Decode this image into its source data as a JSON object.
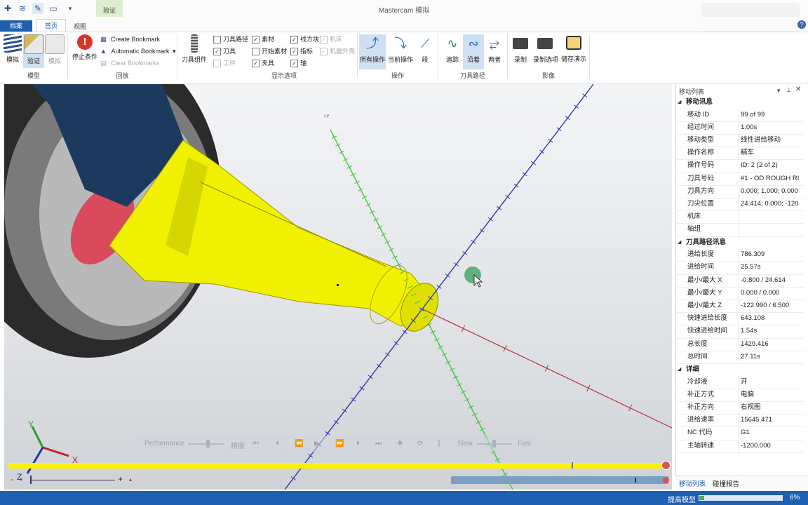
{
  "app": {
    "title": "Mastercam 模拟",
    "context_tab": "验证",
    "context_tab_sub": "验证"
  },
  "tabs": {
    "file": "档案",
    "home": "首页",
    "view": "视图"
  },
  "ribbon": {
    "model_group": {
      "label": "模型",
      "simulate": "模拟",
      "verify": "验证",
      "simulate2": "模拟"
    },
    "playback_group": {
      "label": "回放",
      "stop_condition": "停止条件",
      "create_bookmark": "Create Bookmark",
      "auto_bookmark": "Automatic Bookmark",
      "clear_bookmarks": "Clear Bookmarks"
    },
    "display_group": {
      "label": "显示选项",
      "tool_assembly": "刀具组件",
      "options": [
        {
          "label": "刀具路径",
          "checked": false,
          "disabled": false
        },
        {
          "label": "素材",
          "checked": true,
          "disabled": false
        },
        {
          "label": "线方块",
          "checked": true,
          "disabled": false
        },
        {
          "label": "机床",
          "checked": true,
          "disabled": true
        },
        {
          "label": "刀具",
          "checked": true,
          "disabled": false
        },
        {
          "label": "开始素材",
          "checked": false,
          "disabled": false
        },
        {
          "label": "指标",
          "checked": true,
          "disabled": false
        },
        {
          "label": "机器外壳",
          "checked": true,
          "disabled": true
        },
        {
          "label": "工件",
          "checked": false,
          "disabled": true
        },
        {
          "label": "夹具",
          "checked": true,
          "disabled": false
        },
        {
          "label": "轴",
          "checked": true,
          "disabled": false
        }
      ]
    },
    "operation_group": {
      "label": "操作",
      "all_ops": "所有操作",
      "current_op": "当前操作",
      "segment": "段"
    },
    "toolpath_group": {
      "label": "刀具路径",
      "trace": "追踪",
      "along": "沿着",
      "both": "两者"
    },
    "video_group": {
      "label": "影像",
      "record": "录制",
      "record_options": "录制选项",
      "save_demo": "储存演示"
    }
  },
  "viewport": {
    "axis_label_y": "+Y",
    "triad": {
      "x": "X",
      "y": "Y",
      "z": "Z"
    }
  },
  "playback": {
    "performance": "Performance",
    "accuracy": "精度",
    "slow": "Slow",
    "fast": "Fast",
    "minus": "-",
    "plus": "+"
  },
  "colors": {
    "workpiece": "#f0f000",
    "axis_blue": "#2f3aa8",
    "axis_green": "#3ec83e",
    "axis_red": "#b8323c",
    "timeline": "#fff200",
    "accent": "#1d5fb0"
  },
  "panel": {
    "title": "移动列表",
    "sections": [
      {
        "title": "移动讯息",
        "rows": [
          [
            "移动 ID",
            "99 of 99"
          ],
          [
            "经过时间",
            "1.00s"
          ],
          [
            "移动类型",
            "线性进给移动"
          ],
          [
            "操作名称",
            "精车"
          ],
          [
            "操作号码",
            "ID: 2 (2 of 2)"
          ],
          [
            "刀具号码",
            "#1 - OD ROUGH RI"
          ],
          [
            "刀具方向",
            "0.000; 1.000; 0.000"
          ],
          [
            "刀尖位置",
            "24.414; 0.000; -120"
          ],
          [
            "机床",
            ""
          ],
          [
            "轴组",
            ""
          ]
        ]
      },
      {
        "title": "刀具路径讯息",
        "rows": [
          [
            "进给长度",
            "786.309"
          ],
          [
            "进给时间",
            "25.57s"
          ],
          [
            "最小/最大 X",
            "-0.800 / 24.614"
          ],
          [
            "最小/最大 Y",
            "0.000 / 0.000"
          ],
          [
            "最小/最大 Z",
            "-122.990 / 6.500"
          ],
          [
            "快速进给长度",
            "643.108"
          ],
          [
            "快速进给时间",
            "1.54s"
          ],
          [
            "总长度",
            "1429.416"
          ],
          [
            "总时间",
            "27.11s"
          ]
        ]
      },
      {
        "title": "详细",
        "rows": [
          [
            "冷却液",
            "开"
          ],
          [
            "补正方式",
            "电脑"
          ],
          [
            "补正方向",
            "右视图"
          ],
          [
            "进给速率",
            "15645.471"
          ],
          [
            "NC 代码",
            "G1"
          ],
          [
            "主轴转速",
            "-1200.000"
          ]
        ]
      }
    ],
    "tabs": [
      "移动列表",
      "碰撞报告"
    ]
  },
  "status": {
    "label": "提高模型",
    "progress": 6,
    "progress_text": "6%"
  }
}
